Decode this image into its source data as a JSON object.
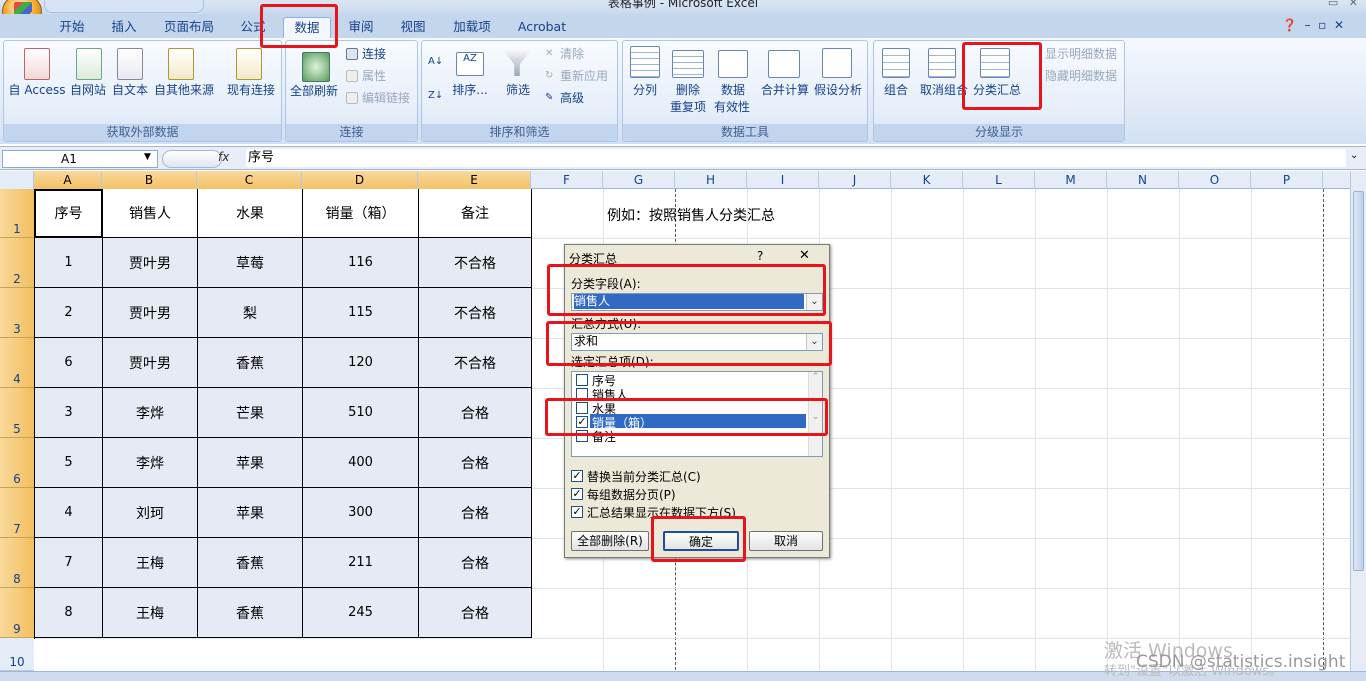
{
  "window": {
    "title": "表格事例 - Microsoft Excel"
  },
  "tabs": [
    {
      "label": "开始"
    },
    {
      "label": "插入"
    },
    {
      "label": "页面布局"
    },
    {
      "label": "公式"
    },
    {
      "label": "数据"
    },
    {
      "label": "审阅"
    },
    {
      "label": "视图"
    },
    {
      "label": "加载项"
    },
    {
      "label": "Acrobat"
    }
  ],
  "ribbon": {
    "external": {
      "label": "获取外部数据",
      "access": "自 Access",
      "web": "自网站",
      "text": "自文本",
      "other": "自其他来源",
      "existing": "现有连接"
    },
    "connections": {
      "label": "连接",
      "refresh": "全部刷新",
      "conn": "连接",
      "props": "属性",
      "edit": "编辑链接"
    },
    "sort": {
      "label": "排序和筛选",
      "sort": "排序...",
      "filter": "筛选",
      "clear": "清除",
      "reapply": "重新应用",
      "advanced": "高级"
    },
    "tools": {
      "label": "数据工具",
      "split": "分列",
      "dedupe1": "删除",
      "dedupe2": "重复项",
      "valid1": "数据",
      "valid2": "有效性",
      "consolidate": "合并计算",
      "whatif": "假设分析"
    },
    "outline": {
      "label": "分级显示",
      "group": "组合",
      "ungroup": "取消组合",
      "subtotal": "分类汇总",
      "show": "显示明细数据",
      "hide": "隐藏明细数据"
    }
  },
  "formula": {
    "name_box": "A1",
    "fx": "fx",
    "value": "序号"
  },
  "columns": [
    "A",
    "B",
    "C",
    "D",
    "E",
    "F",
    "G",
    "H",
    "I",
    "J",
    "K",
    "L",
    "M",
    "N",
    "O",
    "P"
  ],
  "rows": [
    "1",
    "2",
    "3",
    "4",
    "5",
    "6",
    "7",
    "8",
    "9",
    "10"
  ],
  "table": {
    "headers": [
      "序号",
      "销售人",
      "水果",
      "销量（箱）",
      "备注"
    ],
    "data": [
      [
        "1",
        "贾叶男",
        "草莓",
        "116",
        "不合格"
      ],
      [
        "2",
        "贾叶男",
        "梨",
        "115",
        "不合格"
      ],
      [
        "6",
        "贾叶男",
        "香蕉",
        "120",
        "不合格"
      ],
      [
        "3",
        "李烨",
        "芒果",
        "510",
        "合格"
      ],
      [
        "5",
        "李烨",
        "苹果",
        "400",
        "合格"
      ],
      [
        "4",
        "刘珂",
        "苹果",
        "300",
        "合格"
      ],
      [
        "7",
        "王梅",
        "香蕉",
        "211",
        "合格"
      ],
      [
        "8",
        "王梅",
        "香蕉",
        "245",
        "合格"
      ]
    ]
  },
  "note": "例如：按照销售人分类汇总",
  "dialog": {
    "title": "分类汇总",
    "help": "?",
    "close": "✕",
    "field_label": "分类字段(A):",
    "field_value": "销售人",
    "method_label": "汇总方式(U):",
    "method_value": "求和",
    "items_label": "选定汇总项(D):",
    "items": [
      {
        "label": "序号",
        "checked": false
      },
      {
        "label": "销售人",
        "checked": false
      },
      {
        "label": "水果",
        "checked": false
      },
      {
        "label": "销量（箱）",
        "checked": true
      },
      {
        "label": "备注",
        "checked": false
      }
    ],
    "opt_replace": "替换当前分类汇总(C)",
    "opt_pagebreak": "每组数据分页(P)",
    "opt_below": "汇总结果显示在数据下方(S)",
    "btn_remove": "全部删除(R)",
    "btn_ok": "确定",
    "btn_cancel": "取消"
  },
  "watermark": {
    "line1": "激活 Windows",
    "line2": "转到\"设置\"以激活 Windows。",
    "csdn": "CSDN @statistics.insight"
  }
}
